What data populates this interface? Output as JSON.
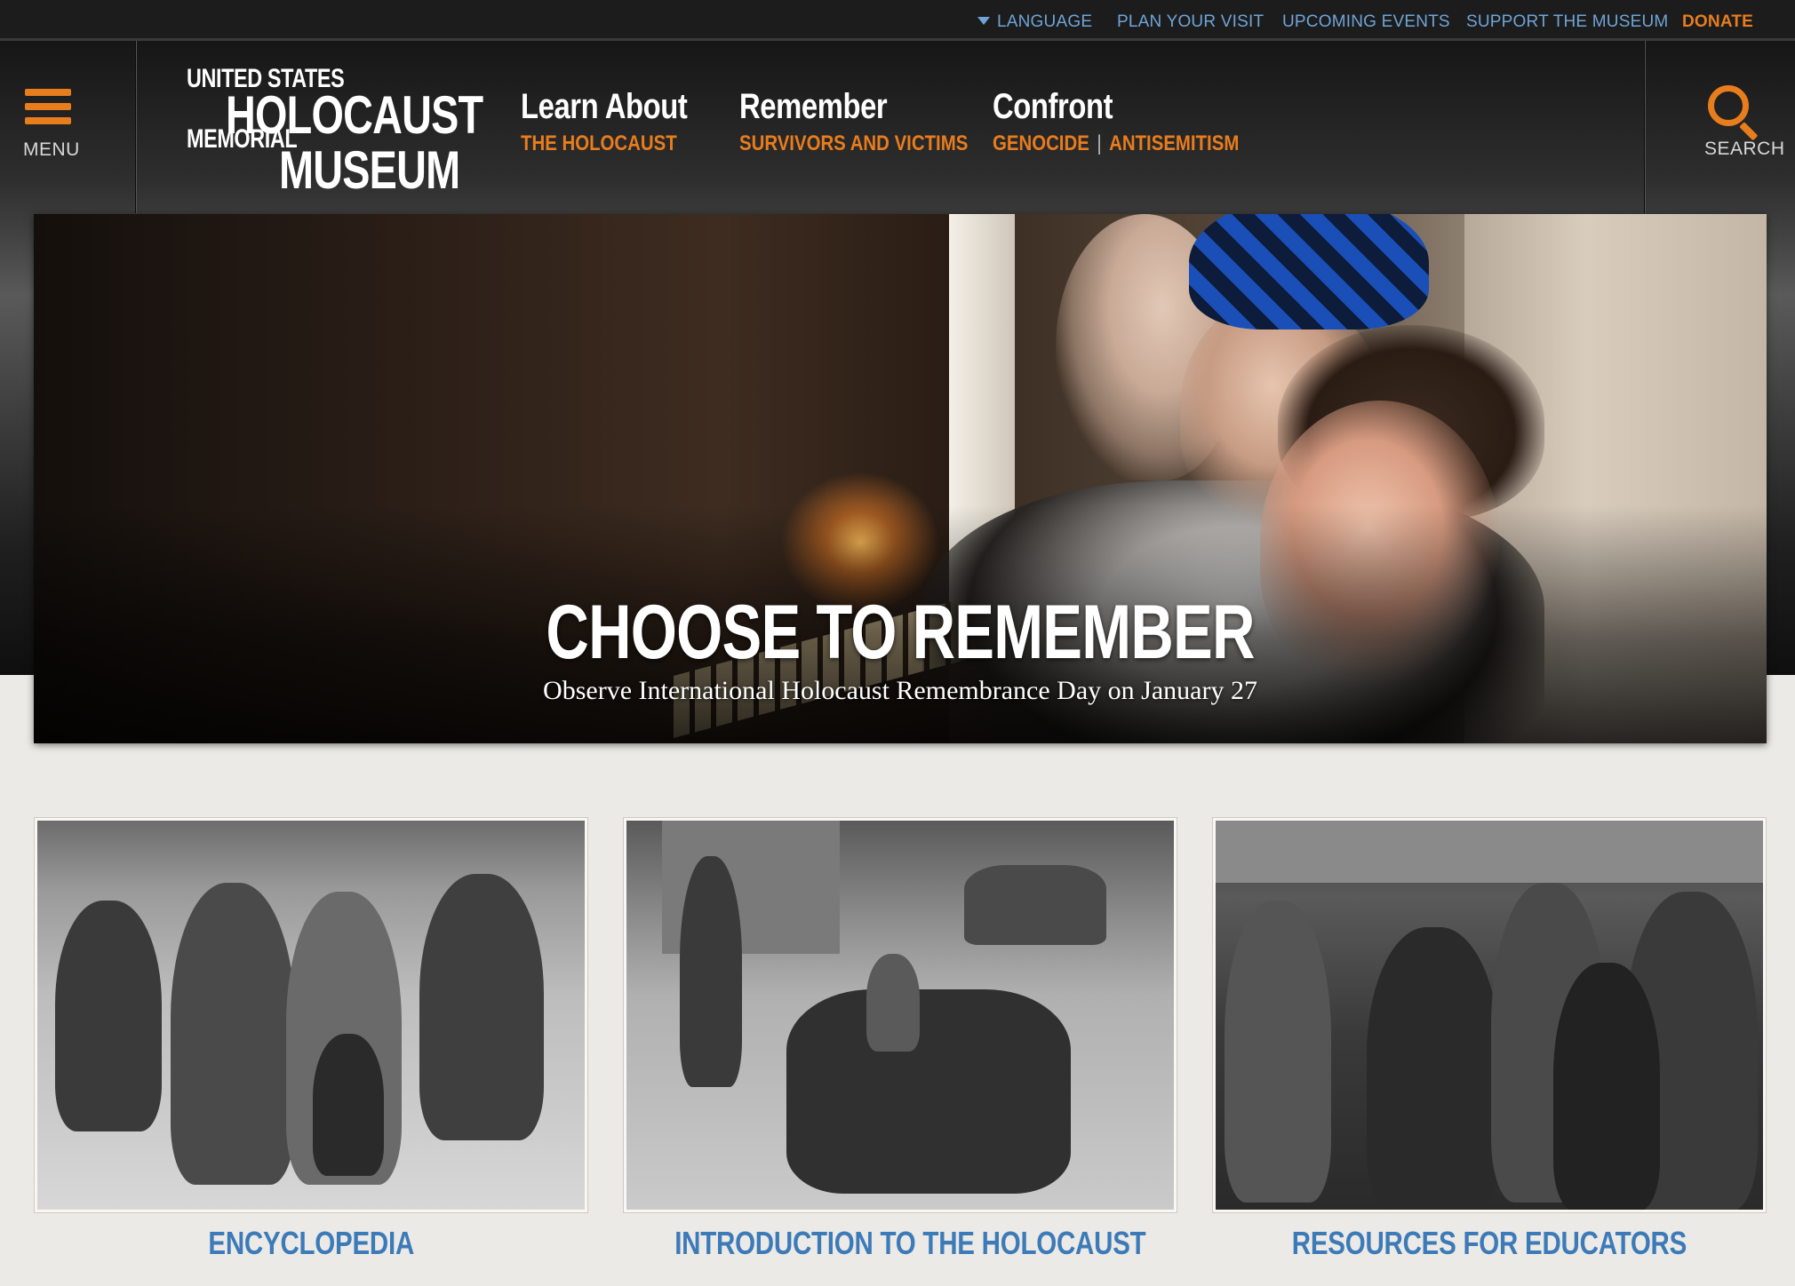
{
  "utility_nav": {
    "language": "LANGUAGE",
    "plan_visit": "PLAN YOUR VISIT",
    "upcoming_events": "UPCOMING EVENTS",
    "support": "SUPPORT THE MUSEUM",
    "donate": "DONATE"
  },
  "header": {
    "menu_label": "MENU",
    "search_label": "SEARCH",
    "logo": {
      "line1": "UNITED STATES",
      "line2": "HOLOCAUST",
      "line3": "MEMORIAL",
      "line4": "MUSEUM"
    },
    "main_nav": [
      {
        "title": "Learn About",
        "links": [
          "THE HOLOCAUST"
        ]
      },
      {
        "title": "Remember",
        "links": [
          "SURVIVORS AND VICTIMS"
        ]
      },
      {
        "title": "Confront",
        "links": [
          "GENOCIDE",
          "ANTISEMITISM"
        ]
      }
    ]
  },
  "hero": {
    "title": "CHOOSE TO REMEMBER",
    "subtitle": "Observe International Holocaust Remembrance Day on January 27"
  },
  "features": [
    {
      "label": "ENCYCLOPEDIA"
    },
    {
      "label": "INTRODUCTION TO THE HOLOCAUST"
    },
    {
      "label": "RESOURCES FOR EDUCATORS"
    }
  ],
  "colors": {
    "accent_orange": "#e87d1e",
    "link_blue": "#6fa4d8",
    "card_label_blue": "#3c7ab8",
    "utility_bg": "#1c1c1c",
    "page_bg": "#eceae6"
  },
  "icons": {
    "menu": "hamburger-icon",
    "search": "magnifier-icon",
    "language": "caret-down-icon"
  }
}
